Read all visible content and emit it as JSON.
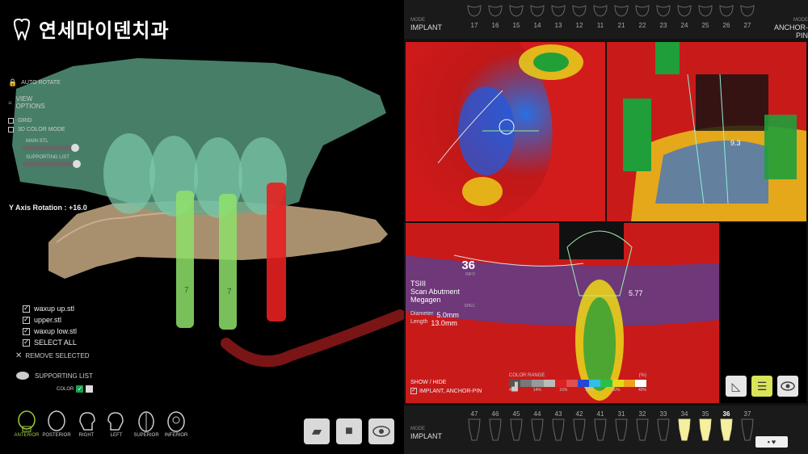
{
  "left": {
    "brand": {
      "name": "연세마이덴치과"
    },
    "auto_rotate_label": "AUTO ROTATE",
    "view_options_label": "VIEW\nOPTIONS",
    "grid_label": "GRID",
    "color_mode_label": "3D COLOR MODE",
    "main_stl_label": "MAIN STL",
    "supporting_list_small_label": "SUPPORTING LIST",
    "axis_rotation_label": "Y Axis Rotation : +16.0",
    "files": [
      {
        "label": "waxup up.stl",
        "checked": true
      },
      {
        "label": "upper.stl",
        "checked": true
      },
      {
        "label": "waxup low.stl",
        "checked": true
      },
      {
        "label": "SELECT ALL",
        "checked": true
      }
    ],
    "remove_selected_label": "REMOVE SELECTED",
    "supporting_list_label": "SUPPORTING LIST",
    "color_label": "COLOR",
    "views": [
      {
        "label": "ANTERIOR",
        "active": true
      },
      {
        "label": "POSTERIOR",
        "active": false
      },
      {
        "label": "RIGHT",
        "active": false
      },
      {
        "label": "LEFT",
        "active": false
      },
      {
        "label": "SUPERIOR",
        "active": false
      },
      {
        "label": "INFERIOR",
        "active": false
      }
    ],
    "implant_numbers": [
      "7",
      "7"
    ]
  },
  "right": {
    "top_mode": {
      "label": "MODE",
      "value": "IMPLANT"
    },
    "top_anchor": {
      "label": "MODE",
      "value": "ANCHOR-PIN"
    },
    "top_teeth": [
      "17",
      "16",
      "15",
      "14",
      "13",
      "12",
      "11",
      "21",
      "22",
      "23",
      "24",
      "25",
      "26",
      "27"
    ],
    "bottom_mode": {
      "label": "MODE",
      "value": "IMPLANT"
    },
    "bottom_teeth": [
      "47",
      "46",
      "45",
      "44",
      "43",
      "42",
      "41",
      "31",
      "32",
      "33",
      "34",
      "35",
      "36",
      "37"
    ],
    "selected_tooth": "36",
    "info": {
      "tooth": "36",
      "tooth_sub": "INFO",
      "brand_line1": "TSIII",
      "brand_line2": "Scan Abutment",
      "brand_line3": "Megagen",
      "spec_label": "SPEC",
      "diameter_label": "Diameter",
      "diameter_value": "5.0mm",
      "length_label": "Length",
      "length_value": "13.0mm"
    },
    "measure_top": "9.3",
    "measure_bottom": "5.77",
    "show_hide_label": "SHOW / HIDE",
    "show_hide_option": "IMPLANT, ANCHOR-PIN",
    "color_range_label": "COLOR RANGE",
    "color_range_unit": "(%)",
    "color_range_ticks": [
      "4%",
      "14%",
      "16%",
      "20%",
      "30%",
      "40%"
    ]
  },
  "colors": {
    "accent_green": "#9ccc3c",
    "implant_green": "#7ee05a",
    "implant_red": "#e52020",
    "crown_green": "#6fbfa0",
    "gum_tan": "#b59a7c"
  }
}
